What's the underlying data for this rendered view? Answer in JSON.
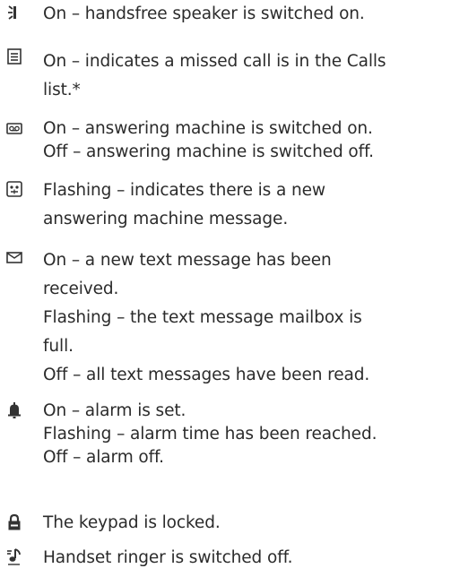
{
  "entries": [
    {
      "icon": "handsfree-speaker-icon",
      "lines": [
        "On – handsfree speaker is switched on."
      ]
    },
    {
      "icon": "calls-list-icon",
      "lines": [
        "On – indicates a missed call is in the Calls",
        "list.*"
      ]
    },
    {
      "icon": "answering-machine-icon",
      "lines": [
        "On – answering machine is switched on.",
        "Off – answering machine is switched off."
      ]
    },
    {
      "icon": "new-message-icon",
      "lines": [
        "Flashing – indicates there is a new",
        "answering machine message."
      ]
    },
    {
      "icon": "envelope-icon",
      "lines": [
        "On – a new text message has been",
        "received.",
        "Flashing – the text message mailbox is",
        "full.",
        "Off –  all text messages have been read."
      ]
    },
    {
      "icon": "alarm-bell-icon",
      "lines": [
        "On – alarm is set.",
        "Flashing – alarm time has been reached.",
        "Off – alarm off."
      ]
    },
    {
      "icon": "padlock-icon",
      "lines": [
        "The keypad is locked."
      ]
    },
    {
      "icon": "ringer-off-icon",
      "lines": [
        "Handset ringer is switched off."
      ]
    }
  ]
}
